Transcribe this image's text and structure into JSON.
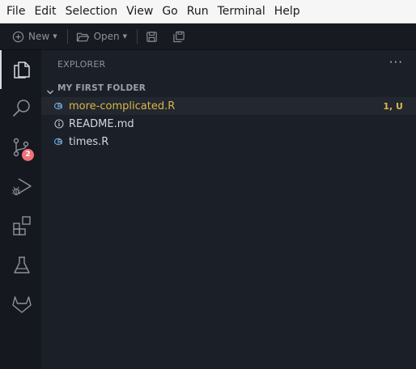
{
  "menubar": {
    "items": [
      "File",
      "Edit",
      "Selection",
      "View",
      "Go",
      "Run",
      "Terminal",
      "Help"
    ]
  },
  "toolbar": {
    "new_label": "New",
    "open_label": "Open",
    "new_icon": "plus-circle-icon",
    "open_icon": "folder-open-icon",
    "save_icon": "save-icon",
    "save_all_icon": "save-all-icon"
  },
  "activitybar": {
    "icons": [
      "explorer-icon",
      "search-icon",
      "source-control-icon",
      "run-debug-icon",
      "extensions-icon",
      "testing-icon",
      "gitlab-icon"
    ],
    "source_control_badge": "2",
    "badge_color": "#f07178"
  },
  "explorer": {
    "title": "EXPLORER",
    "more_label": "···",
    "folder": {
      "label": "MY FIRST FOLDER",
      "expanded": true
    },
    "files": [
      {
        "name": "more-complicated.R",
        "icon": "r-file-icon",
        "status": "1, U",
        "selected": true,
        "modified": true
      },
      {
        "name": "README.md",
        "icon": "info-icon",
        "status": "",
        "selected": false,
        "modified": false
      },
      {
        "name": "times.R",
        "icon": "r-file-icon",
        "status": "",
        "selected": false,
        "modified": false
      }
    ]
  },
  "colors": {
    "modified_text": "#d9b84a",
    "r_icon": "#6ea0cc",
    "background": "#1b1f27"
  }
}
